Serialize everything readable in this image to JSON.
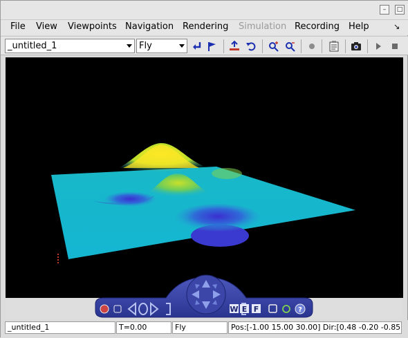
{
  "menu": {
    "file": "File",
    "view": "View",
    "viewpoints": "Viewpoints",
    "navigation": "Navigation",
    "rendering": "Rendering",
    "simulation": "Simulation",
    "recording": "Recording",
    "help": "Help"
  },
  "toolbar": {
    "world_select": "_untitled_1",
    "nav_mode_select": "Fly"
  },
  "status": {
    "world": "_untitled_1",
    "time": "T=0.00",
    "nav_mode": "Fly",
    "pos_dir": "Pos:[-1.00 15.00 30.00] Dir:[0.48 -0.20 -0.85]"
  },
  "dashboard": {
    "walk_key": "W",
    "examine_key": "E",
    "fly_key": "F"
  },
  "colors": {
    "surface_top": "#fde725",
    "surface_base": "#1fb2d0",
    "surface_low": "#3b3ad0",
    "dashboard": "#3a45a8"
  }
}
